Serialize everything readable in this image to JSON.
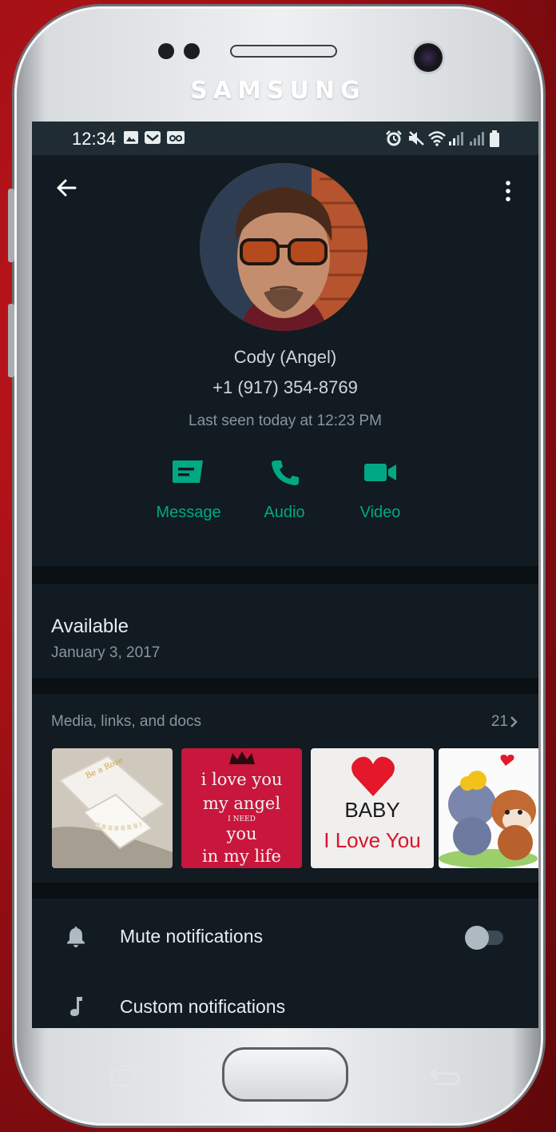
{
  "device": {
    "brand": "SAMSUNG"
  },
  "status_bar": {
    "time": "12:34",
    "left_icons": [
      "image-icon",
      "mail-icon",
      "voicemail-icon"
    ],
    "right_icons": [
      "alarm-icon",
      "mute-icon",
      "wifi-icon",
      "signal-icon",
      "signal-icon",
      "battery-icon"
    ]
  },
  "profile": {
    "name": "Cody (Angel)",
    "phone": "+1 (917) 354-8769",
    "last_seen": "Last seen today at 12:23 PM",
    "actions": [
      {
        "label": "Message",
        "icon": "message-icon"
      },
      {
        "label": "Audio",
        "icon": "phone-icon"
      },
      {
        "label": "Video",
        "icon": "video-icon"
      }
    ]
  },
  "about": {
    "status": "Available",
    "date": "January 3, 2017"
  },
  "media": {
    "title": "Media, links, and docs",
    "count": "21",
    "thumbnails": [
      {
        "kind": "photo",
        "caption": ""
      },
      {
        "kind": "text-card",
        "lines": [
          "i love you",
          "my angel",
          "I NEED",
          "you",
          "in my life"
        ]
      },
      {
        "kind": "text-card",
        "lines": [
          "BABY",
          "I Love You"
        ]
      },
      {
        "kind": "cartoon",
        "caption": ""
      }
    ]
  },
  "settings": [
    {
      "label": "Mute notifications",
      "icon": "bell-icon",
      "toggle": false
    },
    {
      "label": "Custom notifications",
      "icon": "music-note-icon"
    }
  ],
  "colors": {
    "accent": "#00a884",
    "background": "#111b21",
    "status_bar": "#1f2c33",
    "divider": "#0b1014",
    "text_primary": "#e9edef",
    "text_secondary": "#8696a0"
  }
}
